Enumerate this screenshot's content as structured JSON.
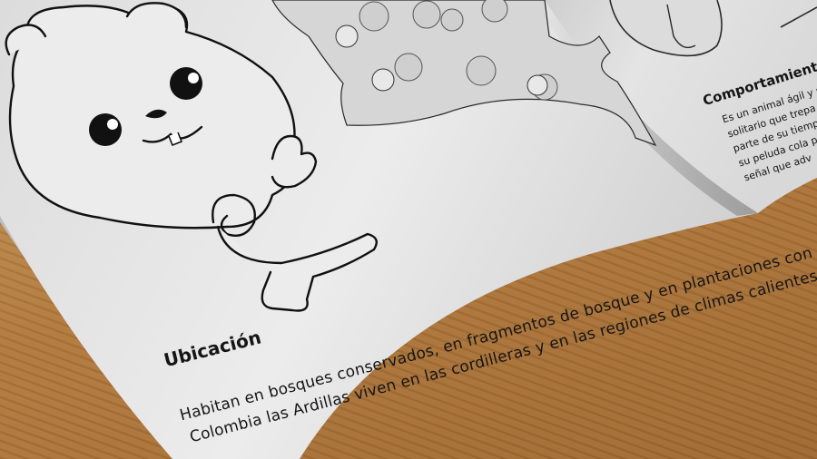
{
  "left_page": {
    "heading": "Ubicación",
    "body_line_1": "Habitan en bosques conservados, en fragmentos de bosque y en plantaciones con cobe",
    "body_line_2": "Colombia las Ardillas viven en las cordilleras y en las regiones de climas calientes de Ámeric"
  },
  "right_page": {
    "heading": "Comportamiento y D",
    "lines": [
      "Es un animal ágil y nerv",
      "solitario que trepa bien",
      "parte de su tiempo e",
      "su peluda cola p",
      "señal que adv"
    ]
  },
  "colors": {
    "paper": "#e9e9e9",
    "ink": "#151515",
    "wood": "#b0793d"
  }
}
